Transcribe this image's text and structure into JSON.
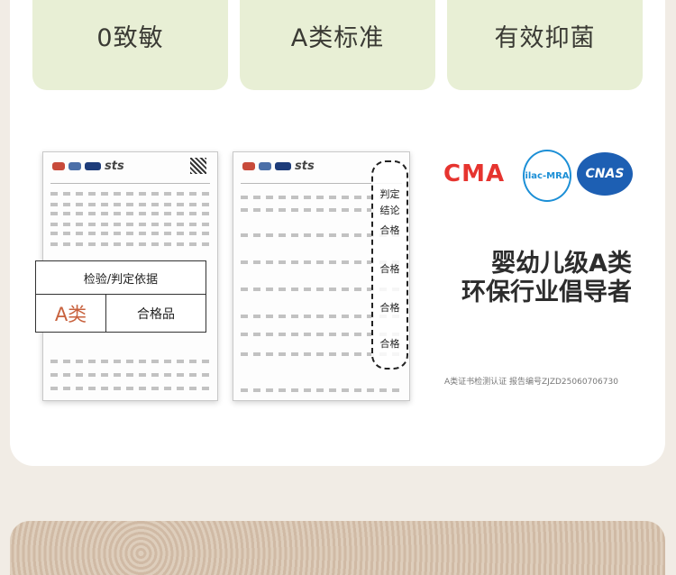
{
  "features": {
    "item1": "0致敏",
    "item2": "A类标准",
    "item3": "有效抑菌"
  },
  "report": {
    "logo_text": "sts",
    "callout_title": "检验/判定依据",
    "callout_grade": "A类",
    "callout_result": "合格品",
    "verdict_title_1": "判定",
    "verdict_title_2": "结论",
    "verdict_result": "合格"
  },
  "certs": {
    "cma": "CMA",
    "mra": "ilac-MRA",
    "cnas": "CNAS"
  },
  "headline": {
    "line1": "婴幼儿级A类",
    "line2": "环保行业倡导者"
  },
  "footnote": "A类证书检测认证 报告编号ZJZD25060706730"
}
